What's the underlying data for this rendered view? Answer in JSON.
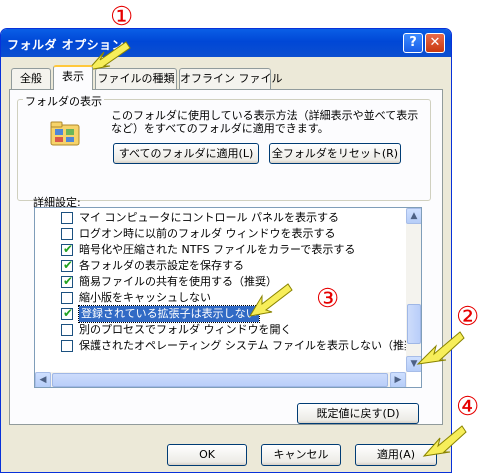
{
  "window": {
    "title": "フォルダ オプション"
  },
  "tabs": [
    {
      "label": "全般",
      "active": false
    },
    {
      "label": "表示",
      "active": true
    },
    {
      "label": "ファイルの種類",
      "active": false
    },
    {
      "label": "オフライン ファイル",
      "active": false
    }
  ],
  "folder_view": {
    "group_label": "フォルダの表示",
    "description": "このフォルダに使用している表示方法（詳細表示や並べて表示など）をすべてのフォルダに適用できます。",
    "description_line1": "このフォルダに使用している表示方法（詳細表示や並べて表示",
    "description_line2": "など）をすべてのフォルダに適用できます。",
    "apply_all_button": "すべてのフォルダに適用(L)",
    "reset_all_button": "全フォルダをリセット(R)"
  },
  "advanced": {
    "label": "詳細設定:",
    "items": [
      {
        "label": "マイ コンピュータにコントロール パネルを表示する",
        "checked": false
      },
      {
        "label": "ログオン時に以前のフォルダ ウィンドウを表示する",
        "checked": false
      },
      {
        "label": "暗号化や圧縮された NTFS ファイルをカラーで表示する",
        "checked": true
      },
      {
        "label": "各フォルダの表示設定を保存する",
        "checked": true
      },
      {
        "label": "簡易ファイルの共有を使用する（推奨）",
        "checked": true
      },
      {
        "label": "縮小版をキャッシュしない",
        "checked": false
      },
      {
        "label": "登録されている拡張子は表示しない",
        "checked": true,
        "selected": true
      },
      {
        "label": "別のプロセスでフォルダ ウィンドウを開く",
        "checked": false
      },
      {
        "label": "保護されたオペレーティング システム ファイルを表示しない（推奨）",
        "checked": false
      }
    ],
    "restore_defaults_button": "既定値に戻す(D)"
  },
  "footer": {
    "ok_button": "OK",
    "cancel_button": "キャンセル",
    "apply_button": "適用(A)"
  },
  "annotations": [
    {
      "marker": "①"
    },
    {
      "marker": "②"
    },
    {
      "marker": "③"
    },
    {
      "marker": "④"
    }
  ],
  "colors": {
    "title_bar": "#0054e3",
    "selection": "#316ac5",
    "check": "#21a121",
    "callout": "#e60000",
    "arrow_fill": "#f7ee5a"
  }
}
